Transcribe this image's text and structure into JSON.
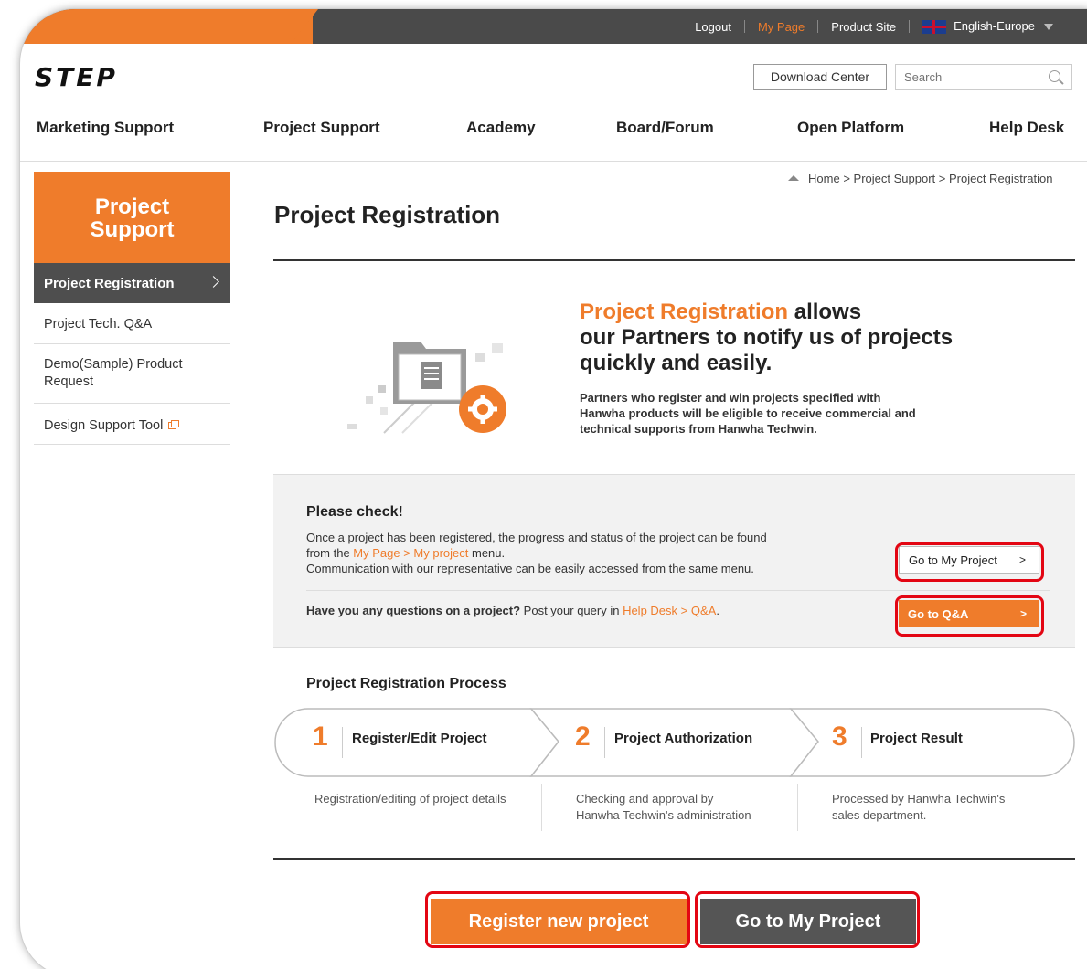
{
  "topbar": {
    "logout": "Logout",
    "my_page": "My Page",
    "product_site": "Product Site",
    "language": "English-Europe"
  },
  "header": {
    "logo": "STEP",
    "download_center": "Download Center",
    "search_placeholder": "Search"
  },
  "main_nav": [
    "Marketing Support",
    "Project Support",
    "Academy",
    "Board/Forum",
    "Open Platform",
    "Help Desk"
  ],
  "sidebar": {
    "title_line1": "Project",
    "title_line2": "Support",
    "items": [
      {
        "label": "Project Registration",
        "active": true
      },
      {
        "label": "Project Tech. Q&A"
      },
      {
        "label_line1": "Demo(Sample) Product",
        "label_line2": "Request"
      },
      {
        "label": "Design Support Tool"
      }
    ]
  },
  "breadcrumb": {
    "home": "Home",
    "sep": ">",
    "level1": "Project Support",
    "level2": "Project Registration"
  },
  "page_title": "Project Registration",
  "intro": {
    "highlight": "Project Registration",
    "line1_rest": " allows",
    "line2": "our Partners to notify us of projects",
    "line3": "quickly and easily.",
    "sub1": "Partners who register and win projects specified with",
    "sub2": "Hanwha products will be eligible to receive commercial and",
    "sub3": "technical supports from Hanwha Techwin."
  },
  "check": {
    "title": "Please check!",
    "line1": "Once a project has been registered, the progress and status of the project can be found",
    "line2_pre": "from the ",
    "line2_link": "My Page > My project",
    "line2_post": " menu.",
    "line3": "Communication with our representative can be easily accessed from the same menu.",
    "question_bold": "Have you any questions on a project?",
    "question_rest": " Post your query in ",
    "question_link": "Help Desk > Q&A",
    "question_end": ".",
    "btn_my_project": "Go to My Project",
    "btn_qa": "Go to Q&A",
    "chev": ">"
  },
  "process": {
    "title": "Project Registration Process",
    "steps": [
      {
        "num": "1",
        "label": "Register/Edit Project",
        "desc1": "Registration/editing of project details",
        "desc2": ""
      },
      {
        "num": "2",
        "label": "Project Authorization",
        "desc1": "Checking and approval by",
        "desc2": "Hanwha Techwin's administration"
      },
      {
        "num": "3",
        "label": "Project Result",
        "desc1": "Processed by Hanwha Techwin's",
        "desc2": "sales department."
      }
    ]
  },
  "actions": {
    "register": "Register new project",
    "go_to_project": "Go to My Project"
  },
  "colors": {
    "accent": "#ef7c2b",
    "dark": "#4a4a4a",
    "highlight_ring": "#e30613"
  }
}
